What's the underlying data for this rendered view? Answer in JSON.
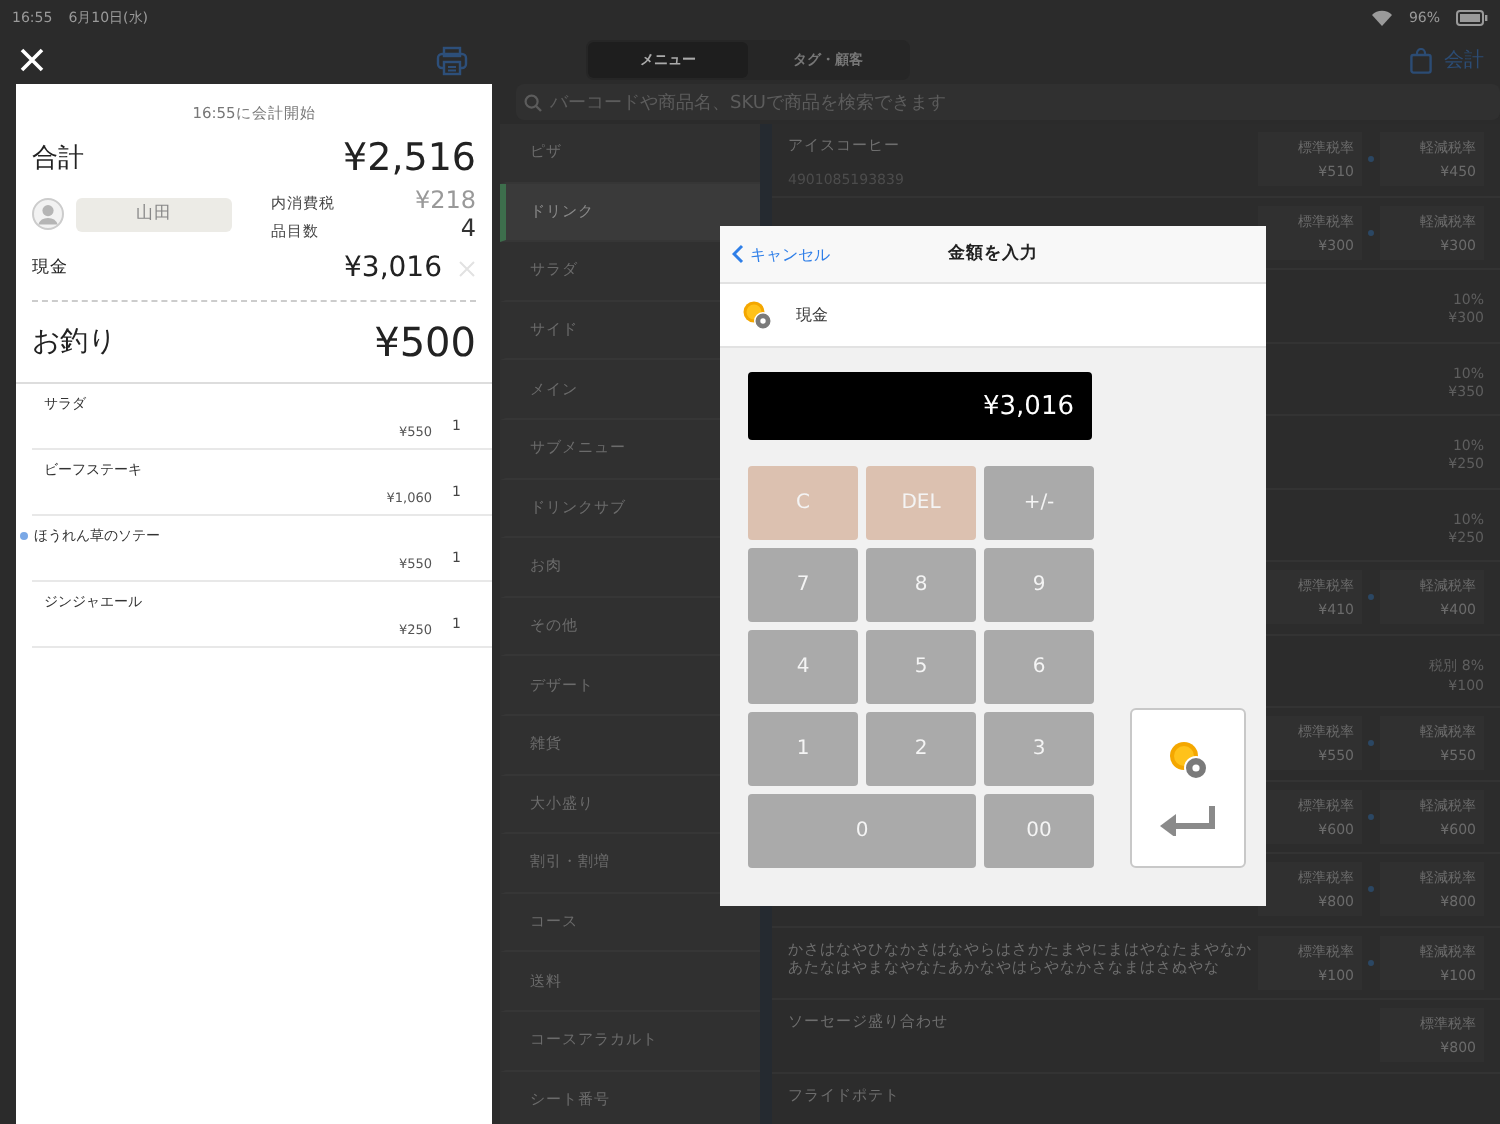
{
  "status_bar": {
    "time": "16:55",
    "date": "6月10日(水)",
    "battery": "96%"
  },
  "toolbar": {
    "segments": [
      {
        "label": "メニュー",
        "selected": true
      },
      {
        "label": "タグ・顧客",
        "selected": false
      }
    ],
    "checkout": "会計"
  },
  "search": {
    "placeholder": "バーコードや商品名、SKUで商品を検索できます"
  },
  "receipt": {
    "started": "16:55に会計開始",
    "total_label": "合計",
    "total": "¥2,516",
    "customer": "山田",
    "tax_label": "内消費税",
    "tax": "¥218",
    "count_label": "品目数",
    "count": "4",
    "payment_label": "現金",
    "payment": "¥3,016",
    "change_label": "お釣り",
    "change": "¥500",
    "items": [
      {
        "name": "サラダ",
        "price": "¥550",
        "qty": "1",
        "marked": false
      },
      {
        "name": "ビーフステーキ",
        "price": "¥1,060",
        "qty": "1",
        "marked": false
      },
      {
        "name": "ほうれん草のソテー",
        "price": "¥550",
        "qty": "1",
        "marked": true
      },
      {
        "name": "ジンジャエール",
        "price": "¥250",
        "qty": "1",
        "marked": false
      }
    ]
  },
  "categories": [
    {
      "label": "ピザ",
      "selected": false
    },
    {
      "label": "ドリンク",
      "selected": true
    },
    {
      "label": "サラダ",
      "selected": false
    },
    {
      "label": "サイド",
      "selected": false
    },
    {
      "label": "メイン",
      "selected": false
    },
    {
      "label": "サブメニュー",
      "selected": false
    },
    {
      "label": "ドリンクサブ",
      "selected": false
    },
    {
      "label": "お肉",
      "selected": false
    },
    {
      "label": "その他",
      "selected": false
    },
    {
      "label": "デザート",
      "selected": false
    },
    {
      "label": "雑貨",
      "selected": false
    },
    {
      "label": "大小盛り",
      "selected": false
    },
    {
      "label": "割引・割増",
      "selected": false
    },
    {
      "label": "コース",
      "selected": false
    },
    {
      "label": "送料",
      "selected": false
    },
    {
      "label": "コースアラカルト",
      "selected": false
    },
    {
      "label": "シート番号",
      "selected": false
    }
  ],
  "products": [
    {
      "kind": "chips",
      "name": "アイスコーヒー",
      "code": "4901085193839",
      "prices": [
        {
          "label": "標準税率",
          "price": "¥510"
        },
        {
          "label": "軽減税率",
          "price": "¥450"
        }
      ]
    },
    {
      "kind": "chips",
      "prices": [
        {
          "label": "標準税率",
          "price": "¥300"
        },
        {
          "label": "軽減税率",
          "price": "¥300"
        }
      ]
    },
    {
      "kind": "rate",
      "rate": "10%",
      "price": "¥300"
    },
    {
      "kind": "rate",
      "rate": "10%",
      "price": "¥350"
    },
    {
      "kind": "rate",
      "rate": "10%",
      "price": "¥250"
    },
    {
      "kind": "rate",
      "rate": "10%",
      "price": "¥250"
    },
    {
      "kind": "chips",
      "prices": [
        {
          "label": "標準税率",
          "price": "¥410"
        },
        {
          "label": "軽減税率",
          "price": "¥400"
        }
      ]
    },
    {
      "kind": "rate",
      "rate": "税別 8%",
      "price": "¥100"
    },
    {
      "kind": "chips",
      "prices": [
        {
          "label": "標準税率",
          "price": "¥550"
        },
        {
          "label": "軽減税率",
          "price": "¥550"
        }
      ]
    },
    {
      "kind": "chips",
      "prices": [
        {
          "label": "標準税率",
          "price": "¥600"
        },
        {
          "label": "軽減税率",
          "price": "¥600"
        }
      ]
    },
    {
      "kind": "chips",
      "prices": [
        {
          "label": "標準税率",
          "price": "¥800"
        },
        {
          "label": "軽減税率",
          "price": "¥800"
        }
      ]
    },
    {
      "kind": "chips",
      "name": "かさはなやひなかさはなやらはさかたまやにまはやなたまやなかあたなはやまなやなたあかなやはらやなかさなまはさぬやな",
      "prices": [
        {
          "label": "標準税率",
          "price": "¥100"
        },
        {
          "label": "軽減税率",
          "price": "¥100"
        }
      ]
    },
    {
      "kind": "chips",
      "name": "ソーセージ盛り合わせ",
      "prices": [
        {
          "label": "標準税率",
          "price": "¥800"
        }
      ]
    },
    {
      "kind": "plain",
      "name": "フライドポテト"
    }
  ],
  "modal": {
    "cancel": "キャンセル",
    "title": "金額を入力",
    "method": "現金",
    "amount": "¥3,016",
    "keys": [
      {
        "label": "C",
        "kind": "action"
      },
      {
        "label": "DEL",
        "kind": "action"
      },
      {
        "label": "+/-",
        "kind": "digit"
      },
      {
        "label": "7",
        "kind": "digit"
      },
      {
        "label": "8",
        "kind": "digit"
      },
      {
        "label": "9",
        "kind": "digit"
      },
      {
        "label": "4",
        "kind": "digit"
      },
      {
        "label": "5",
        "kind": "digit"
      },
      {
        "label": "6",
        "kind": "digit"
      },
      {
        "label": "1",
        "kind": "digit"
      },
      {
        "label": "2",
        "kind": "digit"
      },
      {
        "label": "3",
        "kind": "digit"
      },
      {
        "label": "0",
        "kind": "wide"
      },
      {
        "label": "00",
        "kind": "digit"
      }
    ]
  }
}
